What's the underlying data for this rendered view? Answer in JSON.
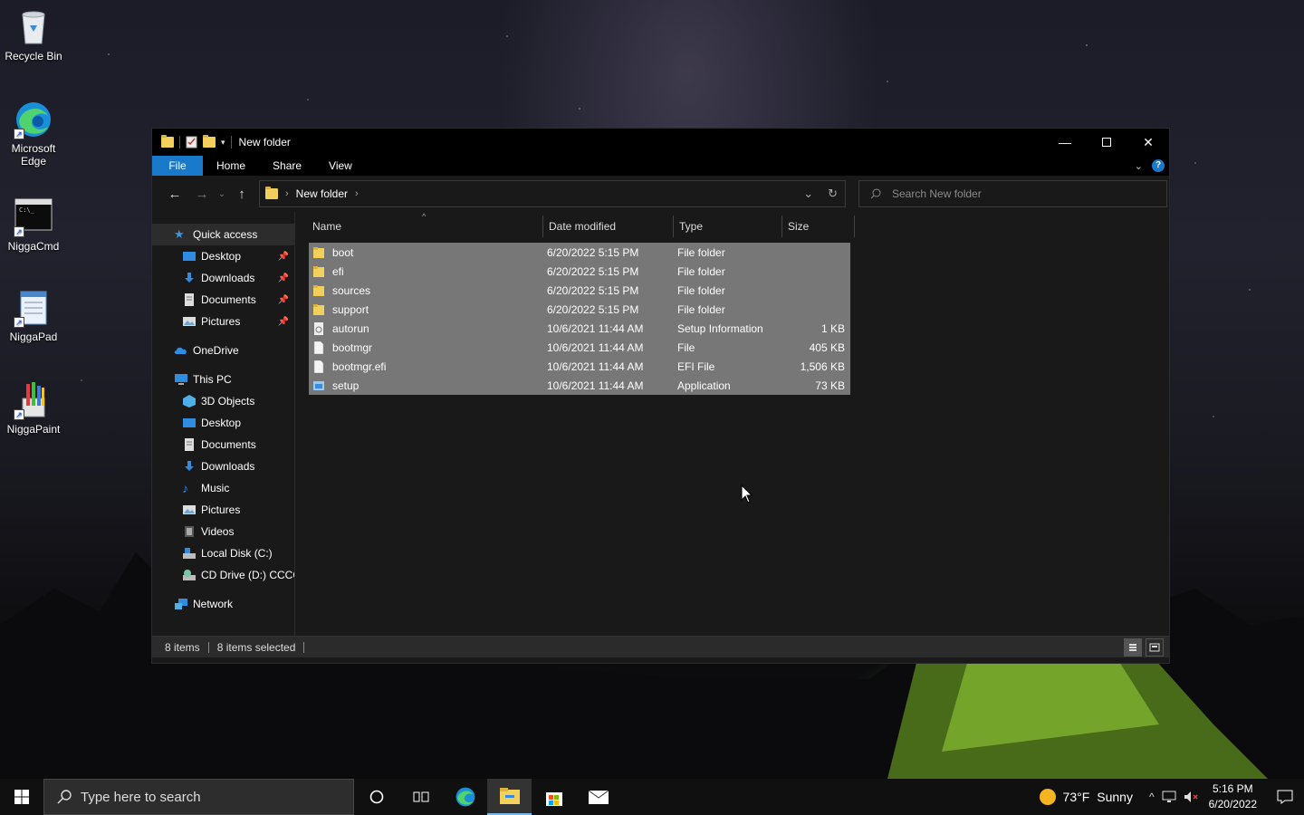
{
  "desktop": {
    "icons": [
      {
        "label": "Recycle Bin"
      },
      {
        "label": "Microsoft Edge"
      },
      {
        "label": "NiggaCmd"
      },
      {
        "label": "NiggaPad"
      },
      {
        "label": "NiggaPaint"
      }
    ]
  },
  "window": {
    "title": "New folder",
    "ribbon_tabs": [
      "File",
      "Home",
      "Share",
      "View"
    ],
    "help_label": "?",
    "address": {
      "crumb": "New folder"
    },
    "search_placeholder": "Search New folder"
  },
  "nav_pane": {
    "quick_access": "Quick access",
    "quick_items": [
      "Desktop",
      "Downloads",
      "Documents",
      "Pictures"
    ],
    "onedrive": "OneDrive",
    "this_pc": "This PC",
    "pc_items": [
      "3D Objects",
      "Desktop",
      "Documents",
      "Downloads",
      "Music",
      "Pictures",
      "Videos",
      "Local Disk (C:)",
      "CD Drive (D:) CCCO"
    ],
    "network": "Network"
  },
  "columns": [
    "Name",
    "Date modified",
    "Type",
    "Size"
  ],
  "files": [
    {
      "name": "boot",
      "date": "6/20/2022 5:15 PM",
      "type": "File folder",
      "size": "",
      "icon": "folder-icon"
    },
    {
      "name": "efi",
      "date": "6/20/2022 5:15 PM",
      "type": "File folder",
      "size": "",
      "icon": "folder-icon"
    },
    {
      "name": "sources",
      "date": "6/20/2022 5:15 PM",
      "type": "File folder",
      "size": "",
      "icon": "folder-icon"
    },
    {
      "name": "support",
      "date": "6/20/2022 5:15 PM",
      "type": "File folder",
      "size": "",
      "icon": "folder-icon"
    },
    {
      "name": "autorun",
      "date": "10/6/2021 11:44 AM",
      "type": "Setup Information",
      "size": "1 KB",
      "icon": "setup-info-icon"
    },
    {
      "name": "bootmgr",
      "date": "10/6/2021 11:44 AM",
      "type": "File",
      "size": "405 KB",
      "icon": "file-icon"
    },
    {
      "name": "bootmgr.efi",
      "date": "10/6/2021 11:44 AM",
      "type": "EFI File",
      "size": "1,506 KB",
      "icon": "file-icon"
    },
    {
      "name": "setup",
      "date": "10/6/2021 11:44 AM",
      "type": "Application",
      "size": "73 KB",
      "icon": "application-icon"
    }
  ],
  "status_bar": {
    "count": "8 items",
    "selected": "8 items selected"
  },
  "taskbar": {
    "search_placeholder": "Type here to search",
    "weather_temp": "73°F",
    "weather_cond": "Sunny",
    "time": "5:16 PM",
    "date": "6/20/2022"
  },
  "colors": {
    "accent": "#1979ca",
    "selection": "#777777",
    "folder": "#f3cf5b"
  }
}
